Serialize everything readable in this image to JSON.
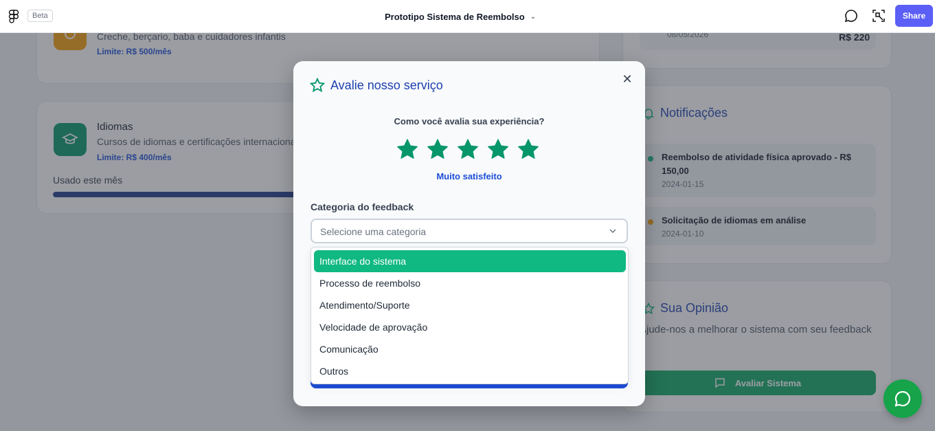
{
  "topbar": {
    "beta": "Beta",
    "title": "Prototipo Sistema de Reembolso",
    "share": "Share"
  },
  "background": {
    "creche": {
      "desc": "Creche, berçario, baba e cuidadores infantis",
      "limit": "Limite: R$ 500/mês"
    },
    "idiomas": {
      "title": "Idiomas",
      "desc": "Cursos de idiomas e certificações internacionais",
      "limit": "Limite: R$ 400/mês",
      "usage_label": "Usado este mês",
      "usage_fraction": 0.75
    },
    "recent": {
      "date": "08/05/2026",
      "amount": "R$ 220"
    },
    "notifications": {
      "heading": "Notificações",
      "items": [
        {
          "title": "Reembolso de atividade física aprovado - R$ 150,00",
          "date": "2024-01-15",
          "dot_color": "#10b981"
        },
        {
          "title": "Solicitação de idiomas em análise",
          "date": "2024-01-10",
          "dot_color": "#f59e0b"
        }
      ]
    },
    "opinion": {
      "heading": "Sua Opinião",
      "text": "Ajude-nos a melhorar o sistema com seu feedback",
      "button": "Avaliar Sistema"
    }
  },
  "modal": {
    "title": "Avalie nosso serviço",
    "question": "Como você avalia sua experiência?",
    "rating": 5,
    "rating_max": 5,
    "rating_label": "Muito satisfeito",
    "category_label": "Categoria do feedback",
    "category_placeholder": "Selecione uma categoria",
    "options": [
      "Interface do sistema",
      "Processo de reembolso",
      "Atendimento/Suporte",
      "Velocidade de aprovação",
      "Comunicação",
      "Outros"
    ],
    "highlighted_option": "Interface do sistema"
  },
  "colors": {
    "accent": "#10b981",
    "brand_blue": "#1d4ed8",
    "share": "#5b5ff5",
    "star": "#059669"
  }
}
